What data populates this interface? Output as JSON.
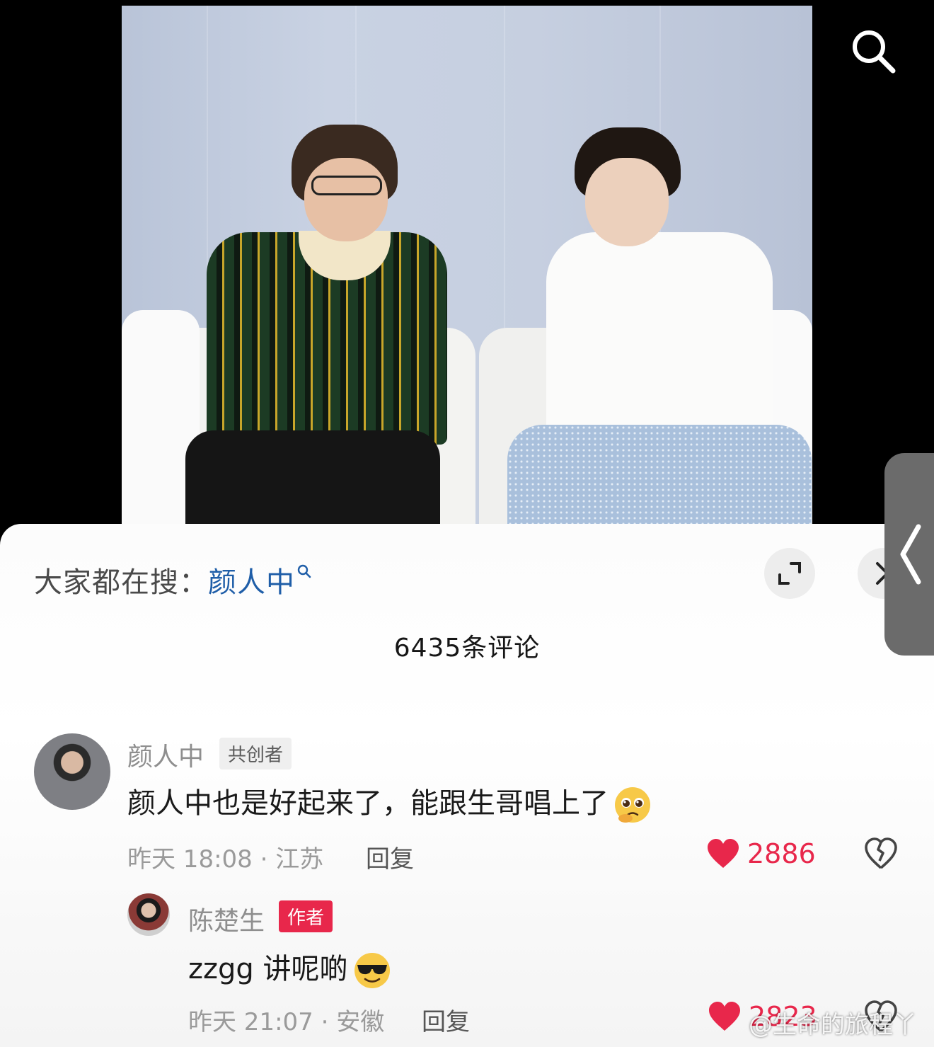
{
  "search_hint": {
    "prefix": "大家都在搜：",
    "keyword": "颜人中"
  },
  "comments_header": {
    "count_label": "6435条评论"
  },
  "comments": [
    {
      "username": "颜人中",
      "tag": "共创者",
      "text": "颜人中也是好起来了，能跟生哥唱上了",
      "emoji": "pleading-face-emoji",
      "time_location": "昨天 18:08 · 江苏",
      "reply_label": "回复",
      "likes": "2886",
      "liked": true
    }
  ],
  "replies": [
    {
      "username": "陈楚生",
      "tag": "作者",
      "text": "zzgg 讲呢啲",
      "emoji": "sunglasses-face-emoji",
      "time_location": "昨天 21:07 · 安徽",
      "reply_label": "回复",
      "likes": "2823",
      "liked": true
    }
  ],
  "watermark": "@生命的旅程丫",
  "colors": {
    "accent_red": "#e8274b",
    "keyword_blue": "#1f5ea8"
  },
  "icons": [
    "search-icon",
    "expand-icon",
    "chevron-right-icon",
    "chevron-left-icon",
    "heart-icon",
    "broken-heart-icon"
  ]
}
